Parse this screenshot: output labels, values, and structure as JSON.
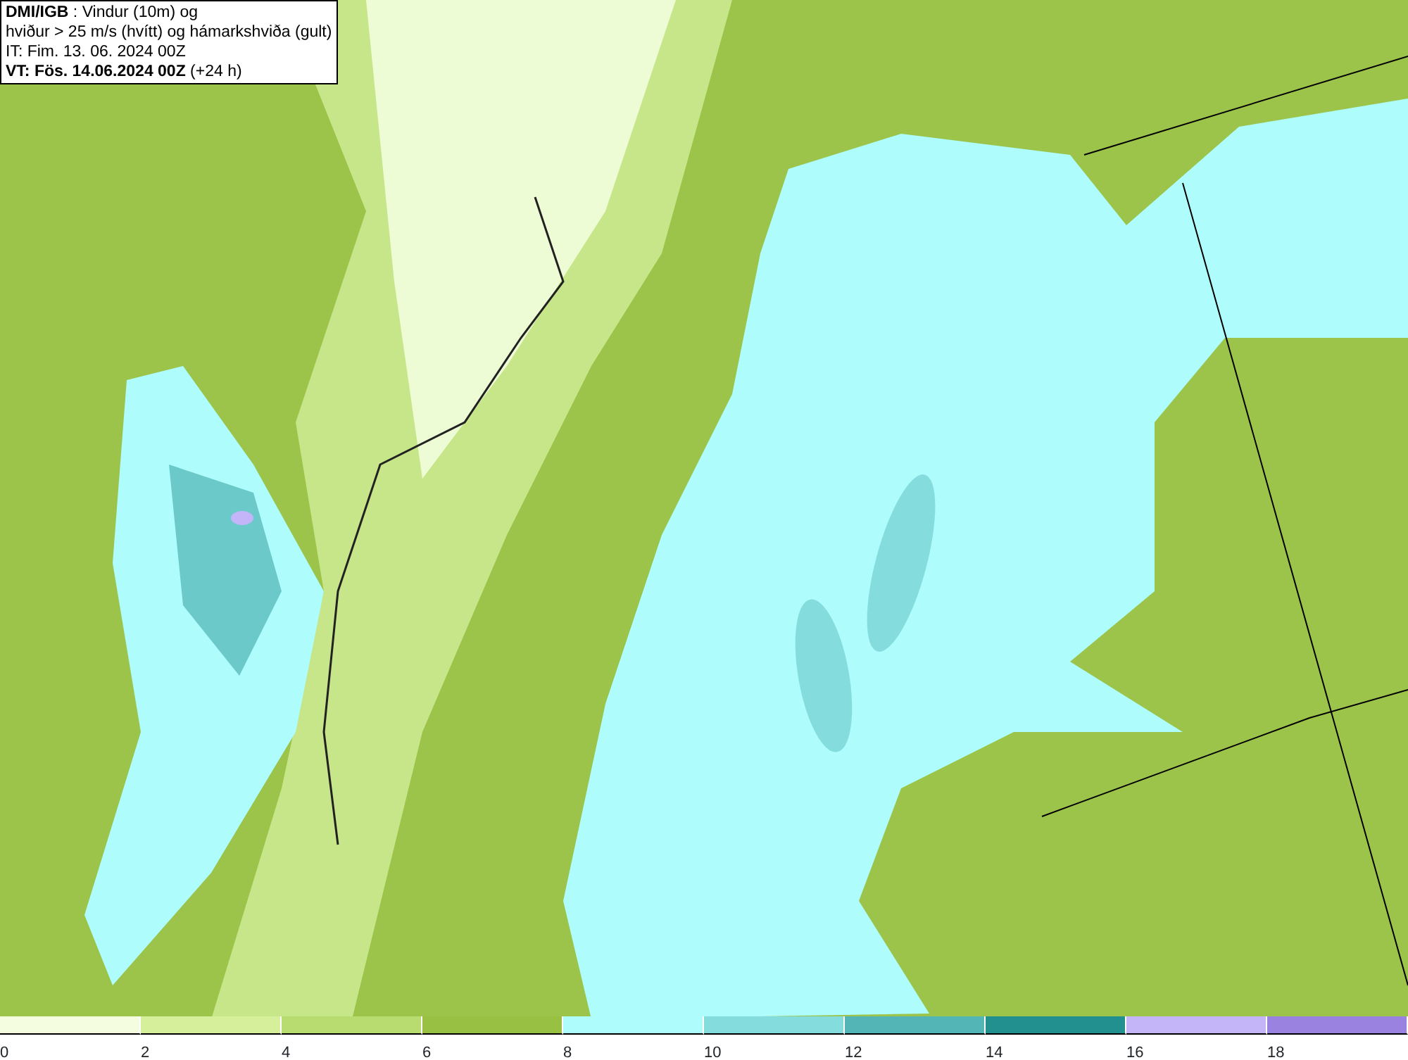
{
  "title_box": {
    "lines": [
      "**DMI/IGB** : Vindur (10m) og",
      "hviður > 25 m/s (hvítt) og hámarkshviða (gult)",
      "IT: Fim. 13. 06. 2024 00Z",
      "**VT: Fös. 14.06.2024 00Z** (+24 h)"
    ]
  },
  "legend": {
    "bins": [
      {
        "color": "#f4fde0",
        "label": "0"
      },
      {
        "color": "#d5ef9a",
        "label": "2"
      },
      {
        "color": "#b8dc70",
        "label": "4"
      },
      {
        "color": "#98c043",
        "label": "6"
      },
      {
        "color": "#aefcfc",
        "label": "8"
      },
      {
        "color": "#84dcdc",
        "label": "10"
      },
      {
        "color": "#53b5b5",
        "label": "12"
      },
      {
        "color": "#22908f",
        "label": "14"
      },
      {
        "color": "#c3b5f8",
        "label": "16"
      },
      {
        "color": "#9a82e0",
        "label": "18"
      }
    ]
  }
}
